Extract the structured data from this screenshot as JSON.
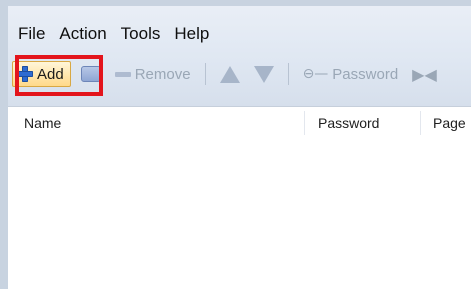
{
  "menubar": {
    "items": [
      {
        "label": "File"
      },
      {
        "label": "Action"
      },
      {
        "label": "Tools"
      },
      {
        "label": "Help"
      }
    ]
  },
  "toolbar": {
    "add_label": "Add",
    "remove_label": "Remove",
    "password_label": "Password"
  },
  "list": {
    "columns": [
      "Name",
      "Password",
      "Page"
    ]
  },
  "annotation": {
    "highlight_color": "#e3141c"
  },
  "icons": [
    "plus-icon",
    "card-icon",
    "minus-icon",
    "arrow-up-icon",
    "arrow-down-icon",
    "key-icon",
    "arrow-icon"
  ]
}
